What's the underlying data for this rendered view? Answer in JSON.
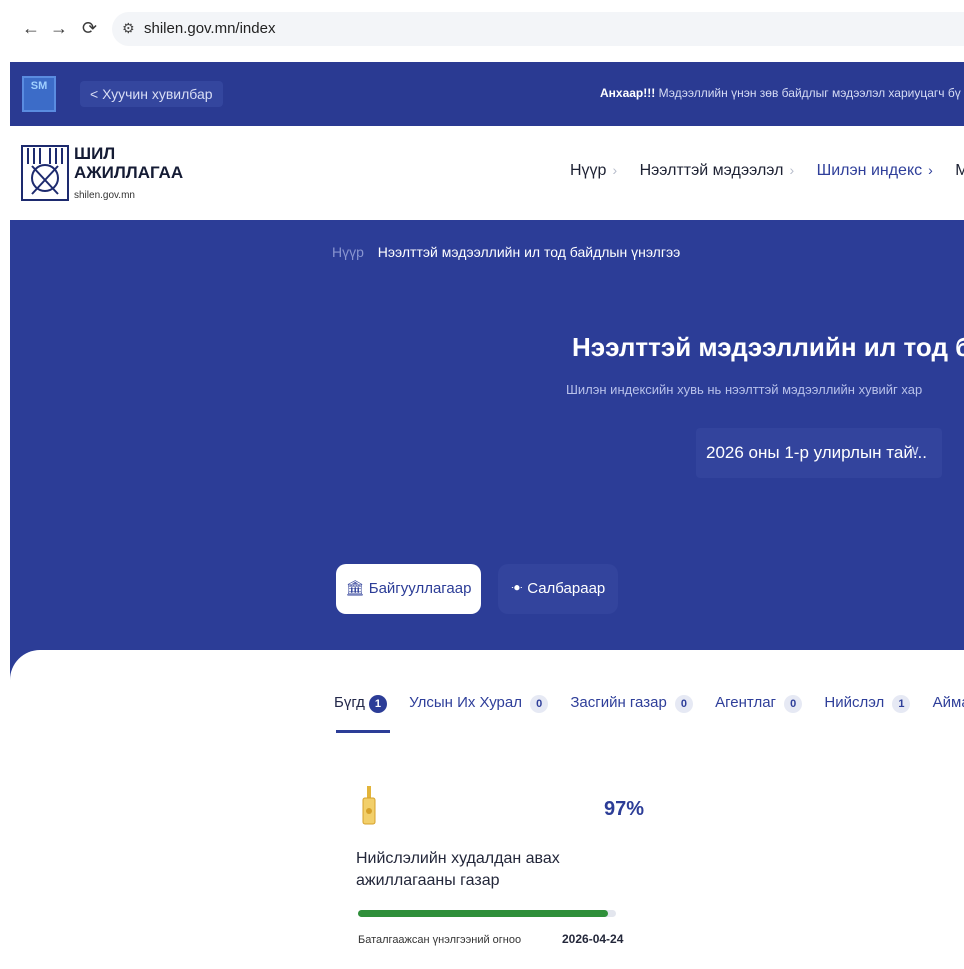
{
  "browser": {
    "url": "shilen.gov.mn/index"
  },
  "topbar": {
    "logo_text": "SM",
    "old_version_label": "< Хуучин хувилбар",
    "notice_bold": "Анхаар!!!",
    "notice_text": " Мэдээллийн үнэн зөв байдлыг мэдээлэл хариуцагч бү"
  },
  "header": {
    "brand_line1": "ШИЛ",
    "brand_line2": "АЖИЛЛАГАА",
    "domain": "shilen.gov.mn",
    "menu": [
      {
        "label": "Нүүр"
      },
      {
        "label": "Нээлттэй мэдээлэл"
      },
      {
        "label": "Шилэн индекс"
      },
      {
        "label": "Мэ"
      }
    ]
  },
  "hero": {
    "breadcrumb_home": "Нүүр",
    "breadcrumb_current": "Нээлттэй мэдээллийн ил тод байдлын үнэлгээ",
    "title": "Нээлттэй мэдээллийн ил тод байдлы",
    "subtitle": "Шилэн индексийн хувь нь нээлттэй мэдээллийн хувийг хар",
    "period_select": "2026 оны 1-р улирлын тай...",
    "toggle_org": "🏛 Байгууллагаар",
    "toggle_sector": "ꔹ Салбараар"
  },
  "tabs": [
    {
      "label": "Бүгд",
      "count": "1"
    },
    {
      "label": "Улсын Их Хурал",
      "count": "0"
    },
    {
      "label": "Засгийн газар",
      "count": "0"
    },
    {
      "label": "Агентлаг",
      "count": "0"
    },
    {
      "label": "Нийслэл",
      "count": "1"
    },
    {
      "label": "Аймаг",
      "count": ""
    }
  ],
  "card": {
    "percent": "97%",
    "percent_value": 0.97,
    "name": "Нийслэлийн худалдан авах ажиллагааны газар",
    "date_label": "Баталгаажсан үнэлгээний огноо",
    "date_value": "2026-04-24"
  },
  "colors": {
    "primary": "#2c3d97",
    "progress": "#2f8f3a",
    "medal": "#e2b43a"
  }
}
